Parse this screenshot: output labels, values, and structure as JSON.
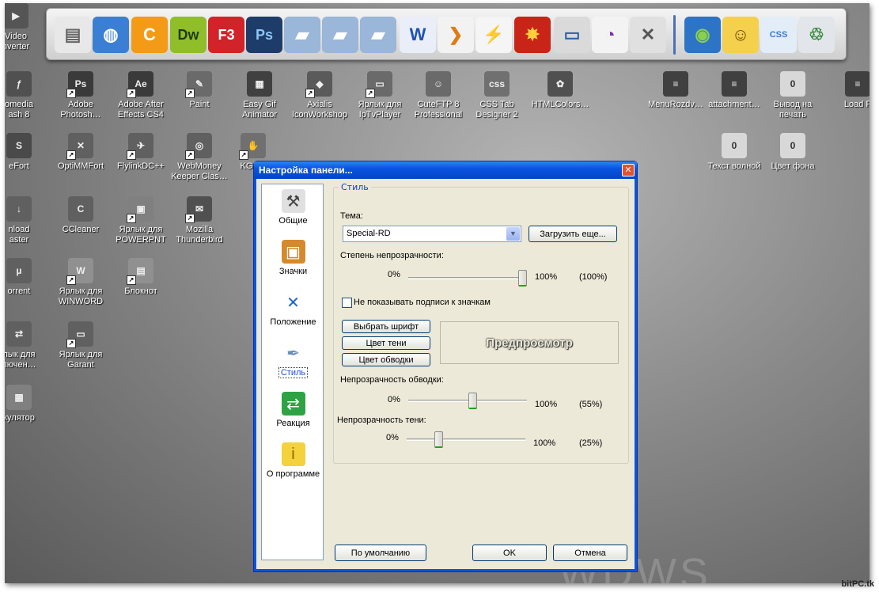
{
  "watermark": "bitPC.tk",
  "dock": {
    "icons": [
      {
        "name": "notepad-icon",
        "glyph": "▤",
        "color": "#e8e8e8",
        "fg": "#666"
      },
      {
        "name": "globe-network-icon",
        "glyph": "◍",
        "color": "#3b7fd4",
        "fg": "#fff"
      },
      {
        "name": "cclean-icon",
        "glyph": "C",
        "color": "#f39a16",
        "fg": "#fff"
      },
      {
        "name": "dreamweaver-icon",
        "glyph": "Dw",
        "color": "#8fbe2a",
        "fg": "#1d3b10"
      },
      {
        "name": "flashget-icon",
        "glyph": "F3",
        "color": "#d2232a",
        "fg": "#fff"
      },
      {
        "name": "photoshop-icon",
        "glyph": "Ps",
        "color": "#1d3c6a",
        "fg": "#8dc6f3"
      },
      {
        "name": "folder-icon",
        "glyph": "▰",
        "color": "#9ab6d8",
        "fg": "#fff"
      },
      {
        "name": "folder-icon-2",
        "glyph": "▰",
        "color": "#9ab6d8",
        "fg": "#fff"
      },
      {
        "name": "folder-icon-3",
        "glyph": "▰",
        "color": "#9ab6d8",
        "fg": "#fff"
      },
      {
        "name": "word-icon",
        "glyph": "W",
        "color": "#e9eef8",
        "fg": "#1f52b3"
      },
      {
        "name": "coloured-arrows-icon",
        "glyph": "❯",
        "color": "#f2f2f2",
        "fg": "#e07a12"
      },
      {
        "name": "lightning-icon",
        "glyph": "⚡",
        "color": "#f5f5f5",
        "fg": "#1d63c8"
      },
      {
        "name": "fire-icon",
        "glyph": "✸",
        "color": "#c92418",
        "fg": "#ffcf3a"
      },
      {
        "name": "computer-icon",
        "glyph": "▭",
        "color": "#dadada",
        "fg": "#2c5fa8"
      },
      {
        "name": "rainbow-icon",
        "glyph": "◔",
        "color": "#f3f3f3",
        "fg": "#7a2fae"
      },
      {
        "name": "tools-icon",
        "glyph": "✕",
        "color": "#e0e0e0",
        "fg": "#555"
      },
      {
        "name": "earth-icon",
        "glyph": "◉",
        "color": "#2d73c6",
        "fg": "#8ad04a"
      },
      {
        "name": "smiley-folder-icon",
        "glyph": "☺",
        "color": "#f4d04c",
        "fg": "#6a4b00"
      },
      {
        "name": "css-file-icon",
        "glyph": "CSS",
        "color": "#e2edf8",
        "fg": "#3a7bc6"
      },
      {
        "name": "recycle-bin-icon",
        "glyph": "♲",
        "color": "#e2e6ea",
        "fg": "#3b8a3f"
      }
    ]
  },
  "desktop": {
    "icons": [
      {
        "name": "video-converter-icon",
        "label": "Video\nnverter",
        "glyph": "▶",
        "color": "#555",
        "shortcut": false
      },
      {
        "name": "macromedia-flash-icon",
        "label": "omedia\nash 8",
        "glyph": "ƒ",
        "color": "#505050",
        "shortcut": false
      },
      {
        "name": "adobe-photoshop-icon",
        "label": "Adobe\nPhotosh…",
        "glyph": "Ps",
        "color": "#3a3a3a",
        "shortcut": true
      },
      {
        "name": "adobe-after-effects-icon",
        "label": "Adobe After\nEffects CS4",
        "glyph": "Ae",
        "color": "#3a3a3a",
        "shortcut": true
      },
      {
        "name": "paint-icon",
        "label": "Paint",
        "glyph": "✎",
        "color": "#6a6a6a",
        "shortcut": true
      },
      {
        "name": "easy-gif-animator-icon",
        "label": "Easy Gif\nAnimator",
        "glyph": "▦",
        "color": "#404040",
        "shortcut": false
      },
      {
        "name": "axialis-iconworkshop-icon",
        "label": "Axialis\nIconWorkshop",
        "glyph": "◆",
        "color": "#5a5a5a",
        "shortcut": true
      },
      {
        "name": "iptvplayer-icon",
        "label": "Ярлык для\nIpTvPlayer",
        "glyph": "▭",
        "color": "#6a6a6a",
        "shortcut": true
      },
      {
        "name": "cuteftp-icon",
        "label": "CuteFTP 8\nProfessional",
        "glyph": "☺",
        "color": "#6a6a6a",
        "shortcut": false
      },
      {
        "name": "css-tab-designer-icon",
        "label": "CSS Tab\nDesigner 2",
        "glyph": "css",
        "color": "#707070",
        "shortcut": false
      },
      {
        "name": "htmlcolors-icon",
        "label": "HTMLColors…",
        "glyph": "✿",
        "color": "#505050",
        "shortcut": false
      },
      {
        "name": "menurozdv-icon",
        "label": "MenuRozdv…",
        "glyph": "≡",
        "color": "#404040",
        "shortcut": false
      },
      {
        "name": "attachment-icon",
        "label": "attachment…",
        "glyph": "≡",
        "color": "#404040",
        "shortcut": false
      },
      {
        "name": "print-output-icon",
        "label": "Вывод на\nпечать",
        "glyph": "0",
        "color": "#d8d8d8",
        "shortcut": false
      },
      {
        "name": "load-file-icon",
        "label": "Load F",
        "glyph": "≡",
        "color": "#404040",
        "shortcut": false
      },
      {
        "name": "safefort-icon",
        "label": "eFort",
        "glyph": "S",
        "color": "#4a4a4a",
        "shortcut": false
      },
      {
        "name": "optimmfort-icon",
        "label": "OptiMMFort",
        "glyph": "✕",
        "color": "#606060",
        "shortcut": true
      },
      {
        "name": "flylinkdc-icon",
        "label": "FlylinkDC++",
        "glyph": "✈",
        "color": "#606060",
        "shortcut": true
      },
      {
        "name": "webmoney-icon",
        "label": "WebMoney\nKeeper Clas…",
        "glyph": "◎",
        "color": "#606060",
        "shortcut": true
      },
      {
        "name": "kgb-icon",
        "label": "KGB A",
        "glyph": "✋",
        "color": "#707070",
        "shortcut": true
      },
      {
        "name": "text-wave-icon",
        "label": "Текст волной",
        "glyph": "0",
        "color": "#d8d8d8",
        "shortcut": false
      },
      {
        "name": "background-color-icon",
        "label": "Цвет фона",
        "glyph": "0",
        "color": "#d8d8d8",
        "shortcut": false
      },
      {
        "name": "download-master-icon",
        "label": "nload\naster",
        "glyph": "↓",
        "color": "#606060",
        "shortcut": false
      },
      {
        "name": "ccleaner-icon",
        "label": "CCleaner",
        "glyph": "C",
        "color": "#606060",
        "shortcut": false
      },
      {
        "name": "powerpnt-shortcut-icon",
        "label": "Ярлык для\nPOWERPNT",
        "glyph": "▣",
        "color": "#808080",
        "shortcut": true
      },
      {
        "name": "thunderbird-icon",
        "label": "Mozilla\nThunderbird",
        "glyph": "✉",
        "color": "#505050",
        "shortcut": true
      },
      {
        "name": "utorrent-icon",
        "label": "orrent",
        "glyph": "µ",
        "color": "#606060",
        "shortcut": false
      },
      {
        "name": "winword-shortcut-icon",
        "label": "Ярлык для\nWINWORD",
        "glyph": "W",
        "color": "#909090",
        "shortcut": true
      },
      {
        "name": "notepad-desktop-icon",
        "label": "Блокнот",
        "glyph": "▤",
        "color": "#909090",
        "shortcut": true
      },
      {
        "name": "connection-shortcut-icon",
        "label": "лык для\nлючен…",
        "glyph": "⇄",
        "color": "#606060",
        "shortcut": false
      },
      {
        "name": "garant-shortcut-icon",
        "label": "Ярлык для\nGarant",
        "glyph": "▭",
        "color": "#606060",
        "shortcut": true
      },
      {
        "name": "calculator-icon",
        "label": "кулятор",
        "glyph": "▦",
        "color": "#808080",
        "shortcut": false
      }
    ]
  },
  "dialog": {
    "title": "Настройка панели...",
    "close_glyph": "✕",
    "nav": [
      {
        "name": "nav-general",
        "label": "Общие",
        "glyph": "⚒",
        "color": "#e0e0e0",
        "fg": "#444",
        "selected": false
      },
      {
        "name": "nav-icons",
        "label": "Значки",
        "glyph": "▣",
        "color": "#d48a2c",
        "fg": "#fff",
        "selected": false
      },
      {
        "name": "nav-position",
        "label": "Положение",
        "glyph": "✕",
        "color": "#fff",
        "fg": "#1f62c6",
        "selected": false
      },
      {
        "name": "nav-style",
        "label": "Стиль",
        "glyph": "✒",
        "color": "#fff",
        "fg": "#6a8fb8",
        "selected": true
      },
      {
        "name": "nav-reaction",
        "label": "Реакция",
        "glyph": "⇄",
        "color": "#2fa344",
        "fg": "#fff",
        "selected": false
      },
      {
        "name": "nav-about",
        "label": "О программе",
        "glyph": "i",
        "color": "#f3d23c",
        "fg": "#8a6a00",
        "selected": false
      }
    ],
    "group_title": "Стиль",
    "theme": {
      "label": "Тема:",
      "value": "Special-RD",
      "load_more": "Загрузить еще..."
    },
    "opacity": {
      "label": "Степень непрозрачности:",
      "min": "0%",
      "max": "100%",
      "value_text": "(100%)",
      "value": 100
    },
    "hide_captions": {
      "label": "Не показывать подписи к значкам",
      "checked": false
    },
    "font_button": "Выбрать шрифт",
    "shadow_color_button": "Цвет тени",
    "border_color_button": "Цвет обводки",
    "preview_text": "Предпросмотр",
    "border_opacity": {
      "label": "Непрозрачность обводки:",
      "min": "0%",
      "max": "100%",
      "value_text": "(55%)",
      "value": 55
    },
    "shadow_opacity": {
      "label": "Непрозрачность тени:",
      "min": "0%",
      "max": "100%",
      "value_text": "(25%)",
      "value": 25
    },
    "default_button": "По умолчанию",
    "ok_button": "OK",
    "cancel_button": "Отмена"
  }
}
